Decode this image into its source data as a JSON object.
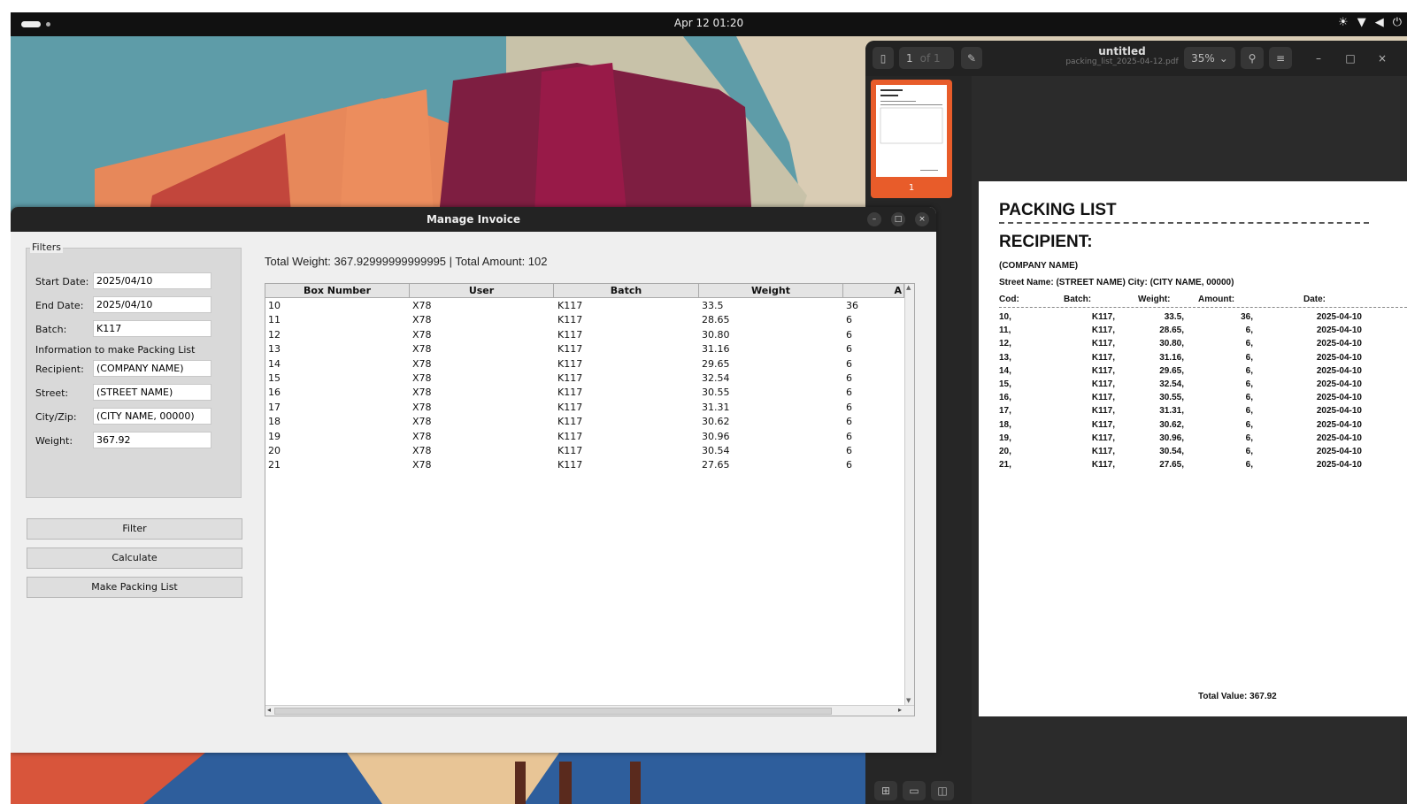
{
  "topbar": {
    "clock": "Apr 12  01:20"
  },
  "pdf_viewer": {
    "page_current": "1",
    "page_of": "of 1",
    "title": "untitled",
    "filename": "packing_list_2025-04-12.pdf",
    "zoom": "35%",
    "thumb_page": "1"
  },
  "document": {
    "title": "PACKING LIST",
    "recipient_heading": "RECIPIENT:",
    "company": "(COMPANY NAME)",
    "address": "Street Name: (STREET NAME) City: (CITY NAME, 00000)",
    "headers": [
      "Cod:",
      "Batch:",
      "Weight:",
      "Amount:",
      "Date:"
    ],
    "rows": [
      [
        "10,",
        "K117,",
        "33.5,",
        "36,",
        "2025-04-10"
      ],
      [
        "11,",
        "K117,",
        "28.65,",
        "6,",
        "2025-04-10"
      ],
      [
        "12,",
        "K117,",
        "30.80,",
        "6,",
        "2025-04-10"
      ],
      [
        "13,",
        "K117,",
        "31.16,",
        "6,",
        "2025-04-10"
      ],
      [
        "14,",
        "K117,",
        "29.65,",
        "6,",
        "2025-04-10"
      ],
      [
        "15,",
        "K117,",
        "32.54,",
        "6,",
        "2025-04-10"
      ],
      [
        "16,",
        "K117,",
        "30.55,",
        "6,",
        "2025-04-10"
      ],
      [
        "17,",
        "K117,",
        "31.31,",
        "6,",
        "2025-04-10"
      ],
      [
        "18,",
        "K117,",
        "30.62,",
        "6,",
        "2025-04-10"
      ],
      [
        "19,",
        "K117,",
        "30.96,",
        "6,",
        "2025-04-10"
      ],
      [
        "20,",
        "K117,",
        "30.54,",
        "6,",
        "2025-04-10"
      ],
      [
        "21,",
        "K117,",
        "27.65,",
        "6,",
        "2025-04-10"
      ]
    ],
    "total": "Total Value: 367.92"
  },
  "window": {
    "title": "Manage Invoice"
  },
  "filters": {
    "legend": "Filters",
    "start_label": "Start Date:",
    "start_value": "2025/04/10",
    "end_label": "End Date:",
    "end_value": "2025/04/10",
    "batch_label": "Batch:",
    "batch_value": "K117",
    "info_label": "Information to make Packing List",
    "recipient_label": "Recipient:",
    "recipient_value": "(COMPANY NAME)",
    "street_label": "Street:",
    "street_value": "(STREET NAME)",
    "city_label": "City/Zip:",
    "city_value": "(CITY NAME, 00000)",
    "weight_label": "Weight:",
    "weight_value": "367.92"
  },
  "buttons": {
    "filter": "Filter",
    "calculate": "Calculate",
    "packing": "Make Packing List"
  },
  "summary": "Total Weight: 367.92999999999995 | Total Amount: 102",
  "table": {
    "headers": [
      "Box Number",
      "User",
      "Batch",
      "Weight",
      "A"
    ],
    "rows": [
      [
        "10",
        "X78",
        "K117",
        "33.5",
        "36"
      ],
      [
        "11",
        "X78",
        "K117",
        "28.65",
        "6"
      ],
      [
        "12",
        "X78",
        "K117",
        "30.80",
        "6"
      ],
      [
        "13",
        "X78",
        "K117",
        "31.16",
        "6"
      ],
      [
        "14",
        "X78",
        "K117",
        "29.65",
        "6"
      ],
      [
        "15",
        "X78",
        "K117",
        "32.54",
        "6"
      ],
      [
        "16",
        "X78",
        "K117",
        "30.55",
        "6"
      ],
      [
        "17",
        "X78",
        "K117",
        "31.31",
        "6"
      ],
      [
        "18",
        "X78",
        "K117",
        "30.62",
        "6"
      ],
      [
        "19",
        "X78",
        "K117",
        "30.96",
        "6"
      ],
      [
        "20",
        "X78",
        "K117",
        "30.54",
        "6"
      ],
      [
        "21",
        "X78",
        "K117",
        "27.65",
        "6"
      ]
    ]
  }
}
